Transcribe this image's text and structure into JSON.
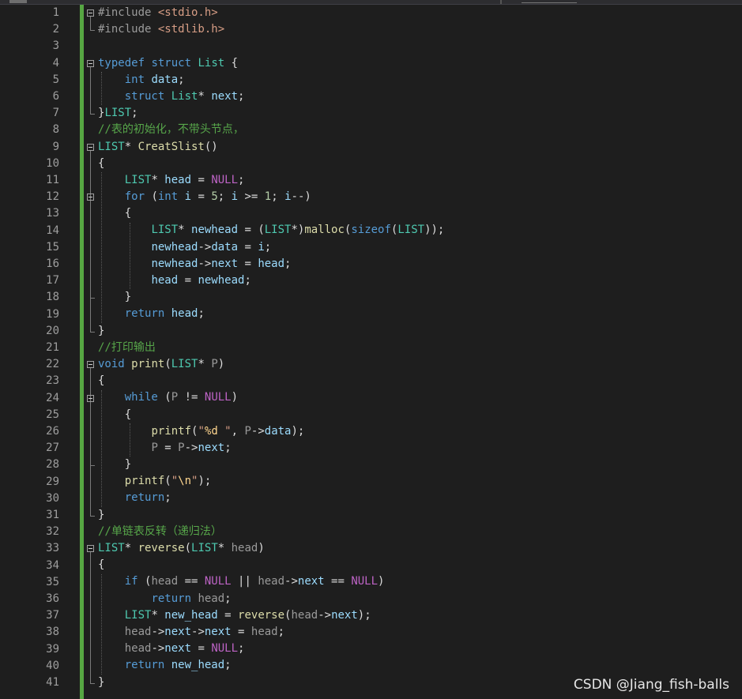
{
  "editor": {
    "line_numbers": [
      "1",
      "2",
      "3",
      "4",
      "5",
      "6",
      "7",
      "8",
      "9",
      "10",
      "11",
      "12",
      "13",
      "14",
      "15",
      "16",
      "17",
      "18",
      "19",
      "20",
      "21",
      "22",
      "23",
      "24",
      "25",
      "26",
      "27",
      "28",
      "29",
      "30",
      "31",
      "32",
      "33",
      "34",
      "35",
      "36",
      "37",
      "38",
      "39",
      "40",
      "41"
    ],
    "lines": [
      [
        [
          "pp",
          "#include "
        ],
        [
          "hdr",
          "<stdio.h>"
        ]
      ],
      [
        [
          "pp",
          "#include "
        ],
        [
          "hdr",
          "<stdlib.h>"
        ]
      ],
      [],
      [
        [
          "kw",
          "typedef"
        ],
        [
          "p",
          " "
        ],
        [
          "kw",
          "struct"
        ],
        [
          "p",
          " "
        ],
        [
          "ty",
          "List"
        ],
        [
          "p",
          " {"
        ]
      ],
      [
        [
          "p",
          "    "
        ],
        [
          "kw",
          "int"
        ],
        [
          "p",
          " "
        ],
        [
          "id",
          "data"
        ],
        [
          "p",
          ";"
        ]
      ],
      [
        [
          "p",
          "    "
        ],
        [
          "kw",
          "struct"
        ],
        [
          "p",
          " "
        ],
        [
          "ty",
          "List"
        ],
        [
          "p",
          "* "
        ],
        [
          "id",
          "next"
        ],
        [
          "p",
          ";"
        ]
      ],
      [
        [
          "p",
          "}"
        ],
        [
          "ty",
          "LIST"
        ],
        [
          "p",
          ";"
        ]
      ],
      [
        [
          "cm",
          "//表的初始化，不带头节点，"
        ]
      ],
      [
        [
          "ty",
          "LIST"
        ],
        [
          "p",
          "* "
        ],
        [
          "fn",
          "CreatSlist"
        ],
        [
          "p",
          "()"
        ]
      ],
      [
        [
          "p",
          "{"
        ]
      ],
      [
        [
          "p",
          "    "
        ],
        [
          "ty",
          "LIST"
        ],
        [
          "p",
          "* "
        ],
        [
          "id",
          "head"
        ],
        [
          "p",
          " = "
        ],
        [
          "mac",
          "NULL"
        ],
        [
          "p",
          ";"
        ]
      ],
      [
        [
          "p",
          "    "
        ],
        [
          "kw",
          "for"
        ],
        [
          "p",
          " ("
        ],
        [
          "kw",
          "int"
        ],
        [
          "p",
          " "
        ],
        [
          "id",
          "i"
        ],
        [
          "p",
          " = "
        ],
        [
          "num",
          "5"
        ],
        [
          "p",
          "; "
        ],
        [
          "id",
          "i"
        ],
        [
          "p",
          " >= "
        ],
        [
          "num",
          "1"
        ],
        [
          "p",
          "; "
        ],
        [
          "id",
          "i"
        ],
        [
          "p",
          "--)"
        ]
      ],
      [
        [
          "p",
          "    {"
        ]
      ],
      [
        [
          "p",
          "        "
        ],
        [
          "ty",
          "LIST"
        ],
        [
          "p",
          "* "
        ],
        [
          "id",
          "newhead"
        ],
        [
          "p",
          " = ("
        ],
        [
          "ty",
          "LIST"
        ],
        [
          "p",
          "*)"
        ],
        [
          "fn",
          "malloc"
        ],
        [
          "p",
          "("
        ],
        [
          "kw",
          "sizeof"
        ],
        [
          "p",
          "("
        ],
        [
          "ty",
          "LIST"
        ],
        [
          "p",
          "));"
        ]
      ],
      [
        [
          "p",
          "        "
        ],
        [
          "id",
          "newhead"
        ],
        [
          "p",
          "->"
        ],
        [
          "id",
          "data"
        ],
        [
          "p",
          " = "
        ],
        [
          "id",
          "i"
        ],
        [
          "p",
          ";"
        ]
      ],
      [
        [
          "p",
          "        "
        ],
        [
          "id",
          "newhead"
        ],
        [
          "p",
          "->"
        ],
        [
          "id",
          "next"
        ],
        [
          "p",
          " = "
        ],
        [
          "id",
          "head"
        ],
        [
          "p",
          ";"
        ]
      ],
      [
        [
          "p",
          "        "
        ],
        [
          "id",
          "head"
        ],
        [
          "p",
          " = "
        ],
        [
          "id",
          "newhead"
        ],
        [
          "p",
          ";"
        ]
      ],
      [
        [
          "p",
          "    }"
        ]
      ],
      [
        [
          "p",
          "    "
        ],
        [
          "kw",
          "return"
        ],
        [
          "p",
          " "
        ],
        [
          "id",
          "head"
        ],
        [
          "p",
          ";"
        ]
      ],
      [
        [
          "p",
          "}"
        ]
      ],
      [
        [
          "cm",
          "//打印输出"
        ]
      ],
      [
        [
          "kw",
          "void"
        ],
        [
          "p",
          " "
        ],
        [
          "fn",
          "print"
        ],
        [
          "p",
          "("
        ],
        [
          "ty",
          "LIST"
        ],
        [
          "p",
          "* "
        ],
        [
          "pm",
          "P"
        ],
        [
          "p",
          ")"
        ]
      ],
      [
        [
          "p",
          "{"
        ]
      ],
      [
        [
          "p",
          "    "
        ],
        [
          "kw",
          "while"
        ],
        [
          "p",
          " ("
        ],
        [
          "pm",
          "P"
        ],
        [
          "p",
          " != "
        ],
        [
          "mac",
          "NULL"
        ],
        [
          "p",
          ")"
        ]
      ],
      [
        [
          "p",
          "    {"
        ]
      ],
      [
        [
          "p",
          "        "
        ],
        [
          "fn",
          "printf"
        ],
        [
          "p",
          "("
        ],
        [
          "str",
          "\""
        ],
        [
          "esc",
          "%d"
        ],
        [
          "str",
          " \""
        ],
        [
          "p",
          ", "
        ],
        [
          "pm",
          "P"
        ],
        [
          "p",
          "->"
        ],
        [
          "id",
          "data"
        ],
        [
          "p",
          ");"
        ]
      ],
      [
        [
          "p",
          "        "
        ],
        [
          "pm",
          "P"
        ],
        [
          "p",
          " = "
        ],
        [
          "pm",
          "P"
        ],
        [
          "p",
          "->"
        ],
        [
          "id",
          "next"
        ],
        [
          "p",
          ";"
        ]
      ],
      [
        [
          "p",
          "    }"
        ]
      ],
      [
        [
          "p",
          "    "
        ],
        [
          "fn",
          "printf"
        ],
        [
          "p",
          "("
        ],
        [
          "str",
          "\""
        ],
        [
          "esc",
          "\\n"
        ],
        [
          "str",
          "\""
        ],
        [
          "p",
          ");"
        ]
      ],
      [
        [
          "p",
          "    "
        ],
        [
          "kw",
          "return"
        ],
        [
          "p",
          ";"
        ]
      ],
      [
        [
          "p",
          "}"
        ]
      ],
      [
        [
          "cm",
          "//单链表反转（递归法）"
        ]
      ],
      [
        [
          "ty",
          "LIST"
        ],
        [
          "p",
          "* "
        ],
        [
          "fn",
          "reverse"
        ],
        [
          "p",
          "("
        ],
        [
          "ty",
          "LIST"
        ],
        [
          "p",
          "* "
        ],
        [
          "pm",
          "head"
        ],
        [
          "p",
          ")"
        ]
      ],
      [
        [
          "p",
          "{"
        ]
      ],
      [
        [
          "p",
          "    "
        ],
        [
          "kw",
          "if"
        ],
        [
          "p",
          " ("
        ],
        [
          "pm",
          "head"
        ],
        [
          "p",
          " == "
        ],
        [
          "mac",
          "NULL"
        ],
        [
          "p",
          " || "
        ],
        [
          "pm",
          "head"
        ],
        [
          "p",
          "->"
        ],
        [
          "id",
          "next"
        ],
        [
          "p",
          " == "
        ],
        [
          "mac",
          "NULL"
        ],
        [
          "p",
          ")"
        ]
      ],
      [
        [
          "p",
          "        "
        ],
        [
          "kw",
          "return"
        ],
        [
          "p",
          " "
        ],
        [
          "pm",
          "head"
        ],
        [
          "p",
          ";"
        ]
      ],
      [
        [
          "p",
          "    "
        ],
        [
          "ty",
          "LIST"
        ],
        [
          "p",
          "* "
        ],
        [
          "id",
          "new_head"
        ],
        [
          "p",
          " = "
        ],
        [
          "fn",
          "reverse"
        ],
        [
          "p",
          "("
        ],
        [
          "pm",
          "head"
        ],
        [
          "p",
          "->"
        ],
        [
          "id",
          "next"
        ],
        [
          "p",
          ");"
        ]
      ],
      [
        [
          "p",
          "    "
        ],
        [
          "pm",
          "head"
        ],
        [
          "p",
          "->"
        ],
        [
          "id",
          "next"
        ],
        [
          "p",
          "->"
        ],
        [
          "id",
          "next"
        ],
        [
          "p",
          " = "
        ],
        [
          "pm",
          "head"
        ],
        [
          "p",
          ";"
        ]
      ],
      [
        [
          "p",
          "    "
        ],
        [
          "pm",
          "head"
        ],
        [
          "p",
          "->"
        ],
        [
          "id",
          "next"
        ],
        [
          "p",
          " = "
        ],
        [
          "mac",
          "NULL"
        ],
        [
          "p",
          ";"
        ]
      ],
      [
        [
          "p",
          "    "
        ],
        [
          "kw",
          "return"
        ],
        [
          "p",
          " "
        ],
        [
          "id",
          "new_head"
        ],
        [
          "p",
          ";"
        ]
      ],
      [
        [
          "p",
          "}"
        ]
      ]
    ]
  },
  "watermark": "CSDN @Jiang_fish-balls",
  "colors": {
    "background": "#1e1e1e",
    "change_bar": "#56a642",
    "keyword": "#569cd6",
    "type": "#4ec9b0",
    "function": "#dcdcaa",
    "comment": "#57a64a",
    "macro": "#bd63c5"
  }
}
